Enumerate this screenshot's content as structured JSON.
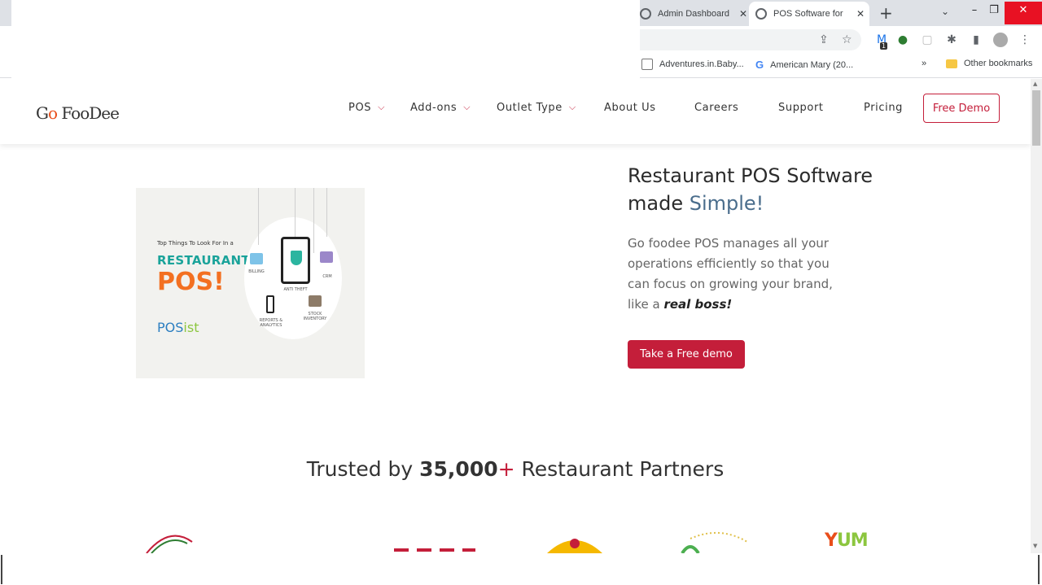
{
  "browser": {
    "tabs": [
      {
        "title": "Admin Dashboard",
        "active": false
      },
      {
        "title": "POS Software for",
        "active": true
      }
    ],
    "bookmarks": [
      {
        "label": "Adventures.in.Baby..."
      },
      {
        "label": "American Mary (20..."
      }
    ],
    "other_bookmarks": "Other bookmarks",
    "overflow": "»",
    "extension_badge": "1"
  },
  "nav": {
    "logo_text": "G",
    "logo_o": "o",
    "logo_rest": "FooDee",
    "items": [
      {
        "label": "POS",
        "dropdown": true
      },
      {
        "label": "Add-ons",
        "dropdown": true
      },
      {
        "label": "Outlet Type",
        "dropdown": true
      },
      {
        "label": "About Us",
        "dropdown": false
      },
      {
        "label": "Careers",
        "dropdown": false
      },
      {
        "label": "Support",
        "dropdown": false
      },
      {
        "label": "Pricing",
        "dropdown": false
      }
    ],
    "demo_button": "Free Demo"
  },
  "hero": {
    "image": {
      "caption_small": "Top Things To Look For In a",
      "caption_restaurant": "RESTAURANT",
      "caption_pos": "POS!",
      "brand_pos": "POS",
      "brand_ist": "ist",
      "labels": {
        "billing": "BILLING",
        "crm": "CRM",
        "anti_theft": "ANTI THEFT",
        "reports": "REPORTS & ANALYTICS",
        "stock": "STOCK INVENTORY"
      }
    },
    "headline_line1": "Restaurant POS Software",
    "headline_line2_prefix": "made ",
    "headline_highlight": "Simple!",
    "description_prefix": "Go foodee POS manages all your operations efficiently so that you can focus on growing your brand, like a ",
    "description_emphasis": "real boss!",
    "cta_label": "Take a Free demo"
  },
  "trusted": {
    "prefix": "Trusted by ",
    "count": "35,000",
    "plus": "+",
    "suffix": " Restaurant Partners"
  },
  "partner_logo_yum": {
    "y": "Y",
    "um": "UM"
  },
  "colors": {
    "brand_red": "#c41e3a",
    "highlight_blue": "#4a6d8c",
    "teal": "#1aa39a",
    "orange": "#f37021"
  }
}
